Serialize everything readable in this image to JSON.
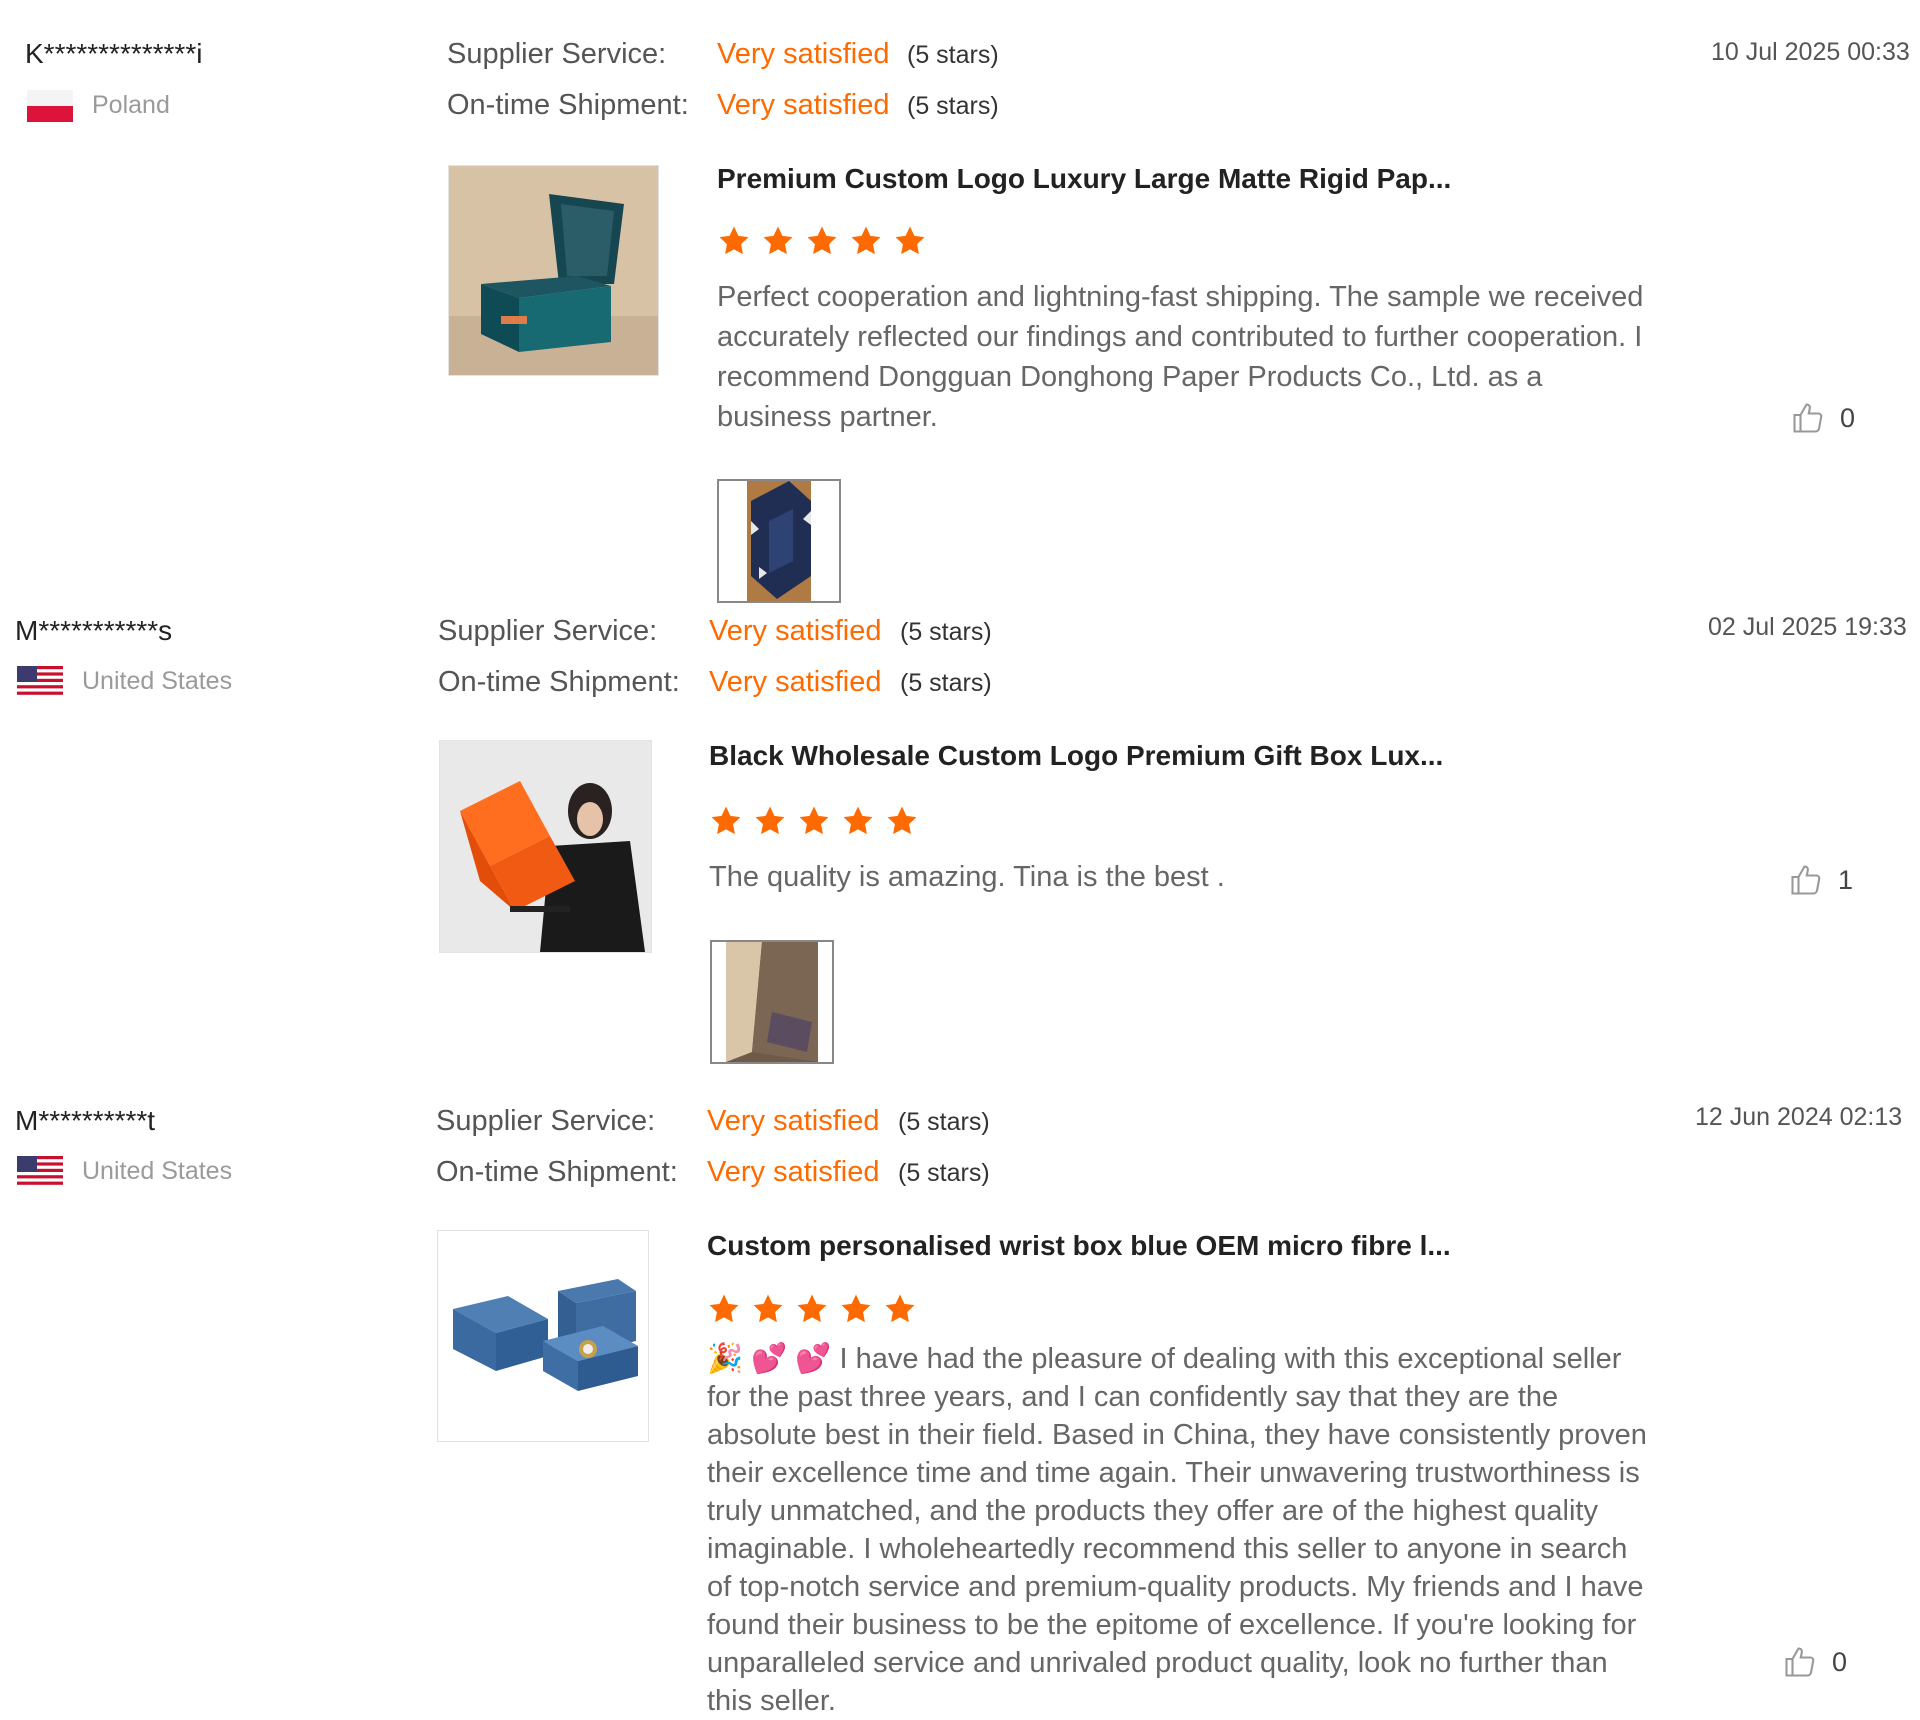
{
  "labels": {
    "supplier_service": "Supplier Service:",
    "ontime_shipment": "On-time Shipment:"
  },
  "accent_color": "#ff6a00",
  "reviews": [
    {
      "user": "K**************i",
      "country": "Poland",
      "flag": "poland-flag",
      "supplier_rating": "Very satisfied",
      "supplier_stars": "(5 stars)",
      "shipment_rating": "Very satisfied",
      "shipment_stars": "(5 stars)",
      "date": "10 Jul 2025 00:33",
      "product_title": "Premium Custom Logo Luxury Large Matte Rigid Pap...",
      "stars": 5,
      "text": "Perfect cooperation and lightning-fast shipping. The sample we received accurately reflected our findings and contributed to further cooperation. I recommend Dongguan Donghong Paper Products Co., Ltd. as a business partner.",
      "likes": "0"
    },
    {
      "user": "M***********s",
      "country": "United States",
      "flag": "us-flag",
      "supplier_rating": "Very satisfied",
      "supplier_stars": "(5 stars)",
      "shipment_rating": "Very satisfied",
      "shipment_stars": "(5 stars)",
      "date": "02 Jul 2025 19:33",
      "product_title": "Black Wholesale Custom Logo Premium Gift Box Lux...",
      "stars": 5,
      "text": "The quality is amazing. Tina is the best .",
      "likes": "1"
    },
    {
      "user": "M**********t",
      "country": "United States",
      "flag": "us-flag",
      "supplier_rating": "Very satisfied",
      "supplier_stars": "(5 stars)",
      "shipment_rating": "Very satisfied",
      "shipment_stars": "(5 stars)",
      "date": "12 Jun 2024 02:13",
      "product_title": "Custom personalised wrist box blue OEM micro fibre l...",
      "stars": 5,
      "emojis": "🎉 💕 💕",
      "text": "I have had the pleasure of dealing with this exceptional seller for the past three years, and I can confidently say that they are the absolute best in their field. Based in China, they have consistently proven their excellence time and time again. Their unwavering trustworthiness is truly unmatched, and the products they offer are of the highest quality imaginable. I wholeheartedly recommend this seller to anyone in search of top-notch service and premium-quality products. My friends and I have found their business to be the epitome of excellence. If you're looking for unparalleled service and unrivaled product quality, look no further than this seller.",
      "likes": "0"
    }
  ]
}
